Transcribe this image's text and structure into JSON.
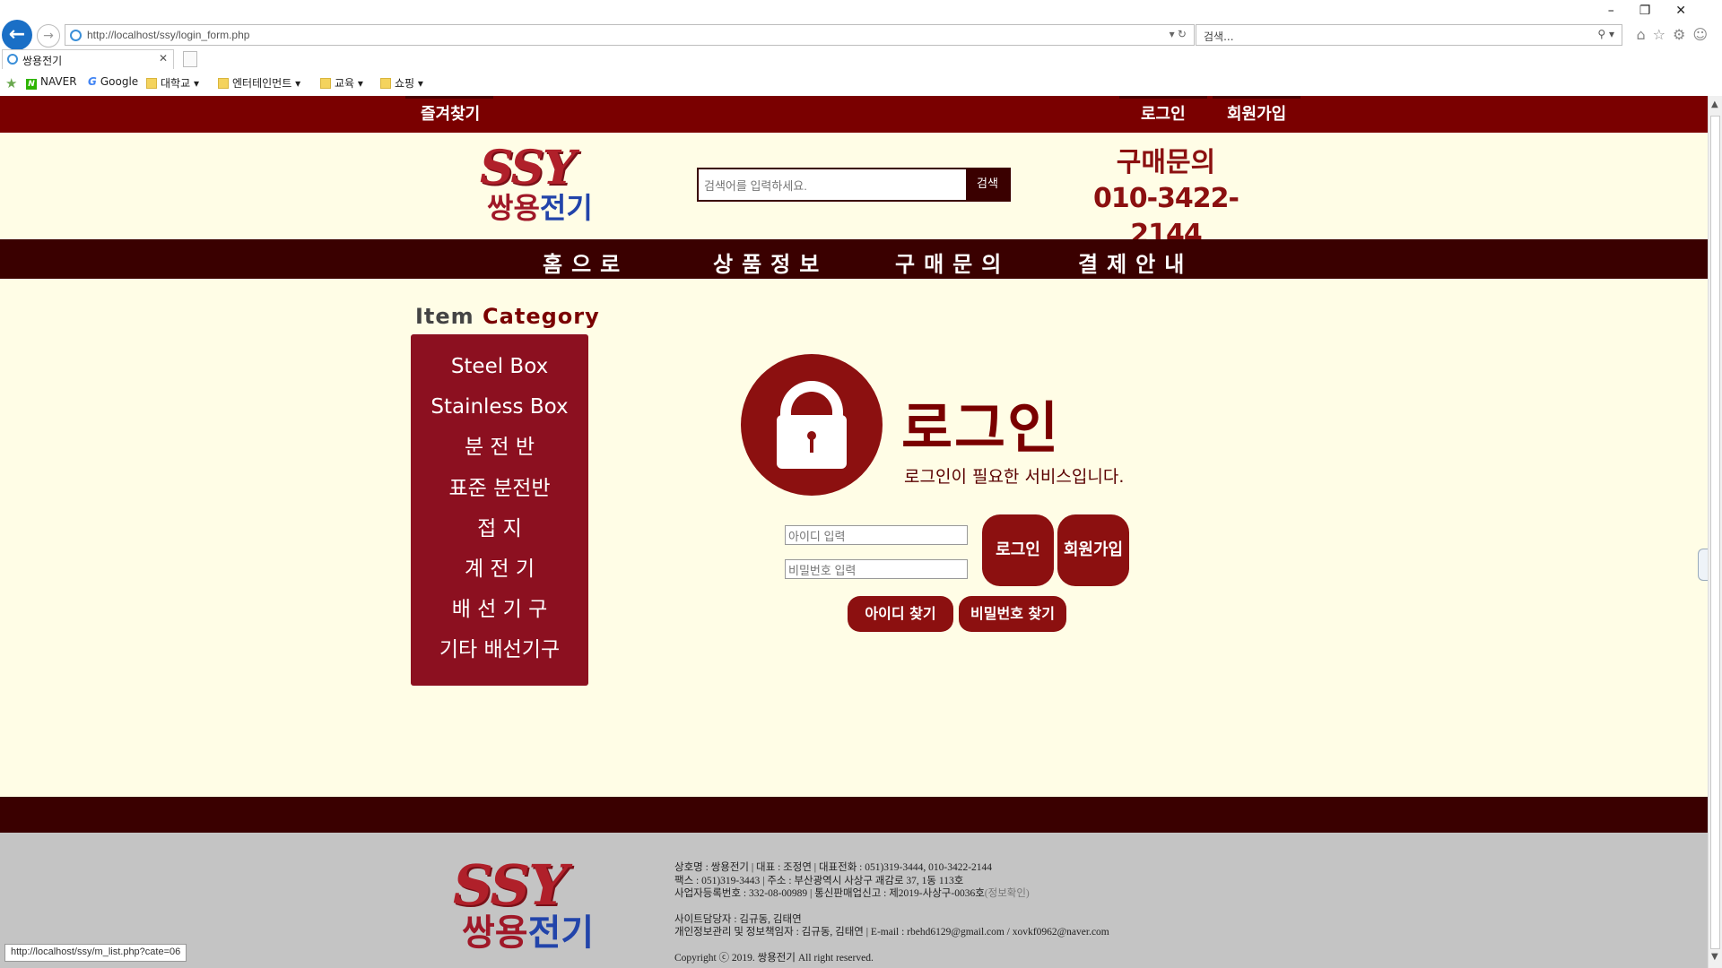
{
  "browser": {
    "url": "http://localhost/ssy/login_form.php",
    "search_placeholder": "검색...",
    "tab_title": "쌍용전기",
    "favorites": [
      "NAVER",
      "Google",
      "대학교",
      "엔터테인먼트",
      "교육",
      "쇼핑"
    ],
    "status_url": "http://localhost/ssy/m_list.php?cate=06"
  },
  "topbar": {
    "bookmark": "즐겨찾기",
    "login": "로그인",
    "signup": "회원가입"
  },
  "header": {
    "logo_ssy": "SSY",
    "logo_name_red": "쌍용",
    "logo_name_blue": "전기",
    "search_placeholder": "검색어를 입력하세요.",
    "search_button": "검색",
    "contact_title": "구매문의",
    "contact_phone": "010-3422-2144"
  },
  "nav": [
    "홈으로",
    "상품정보",
    "구매문의",
    "결제안내"
  ],
  "category": {
    "title_gray": "Item ",
    "title_red": "Category",
    "items": [
      "Steel Box",
      "Stainless Box",
      "분 전 반",
      "표준 분전반",
      "접 지",
      "계 전 기",
      "배 선 기 구",
      "기타 배선기구"
    ]
  },
  "login": {
    "title": "로그인",
    "subtitle": "로그인이 필요한 서비스입니다.",
    "id_placeholder": "아이디 입력",
    "pw_placeholder": "비밀번호 입력",
    "login_button": "로그인",
    "signup_button": "회원가입",
    "find_id": "아이디 찾기",
    "find_pw": "비밀번호 찾기"
  },
  "footer": {
    "line1": "상호명 : 쌍용전기 | 대표 : 조정연 | 대표전화 : 051)319-3444, 010-3422-2144",
    "line2": "팩스 : 051)319-3443 | 주소 : 부산광역시 사상구 괘감로 37, 1동 113호",
    "line3a": "사업자등록번호 : 332-08-00989 | 통신판매업신고 : 제2019-사상구-0036호",
    "line3b": "(정보확인)",
    "line4": "사이트담당자 : 김규동, 김태연",
    "line5": "개인정보관리 및 정보책임자 : 김규동, 김태연 | E-mail : rbehd6129@gmail.com / xovkf0962@naver.com",
    "copyright": "Copyright ⓒ 2019. 쌍용전기 All right reserved."
  }
}
